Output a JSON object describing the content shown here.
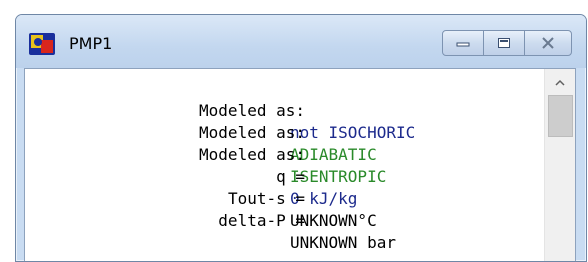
{
  "window": {
    "title": "PMP1",
    "icon": "app-logo-icon",
    "buttons": [
      "minimize-icon",
      "maximize-icon",
      "close-icon"
    ]
  },
  "lines": [
    {
      "label": "Modeled as:",
      "value": "not ISOCHORIC",
      "color": "#1c2a8c"
    },
    {
      "label": "Modeled as:",
      "value": "ADIABATIC",
      "color": "#2a8a2a"
    },
    {
      "label": "Modeled as:",
      "value": "ISENTROPIC",
      "color": "#2a8a2a"
    },
    {
      "label": "q =",
      "value": "0 kJ/kg",
      "color": "#1c2a8c"
    },
    {
      "label": "Tout-s =",
      "value": "UNKNOWN°C",
      "color": "#000000"
    },
    {
      "label": "delta-P =",
      "value": "UNKNOWN bar",
      "color": "#000000"
    }
  ],
  "scrollbar": {
    "up_icon": "chevron-up-icon"
  }
}
